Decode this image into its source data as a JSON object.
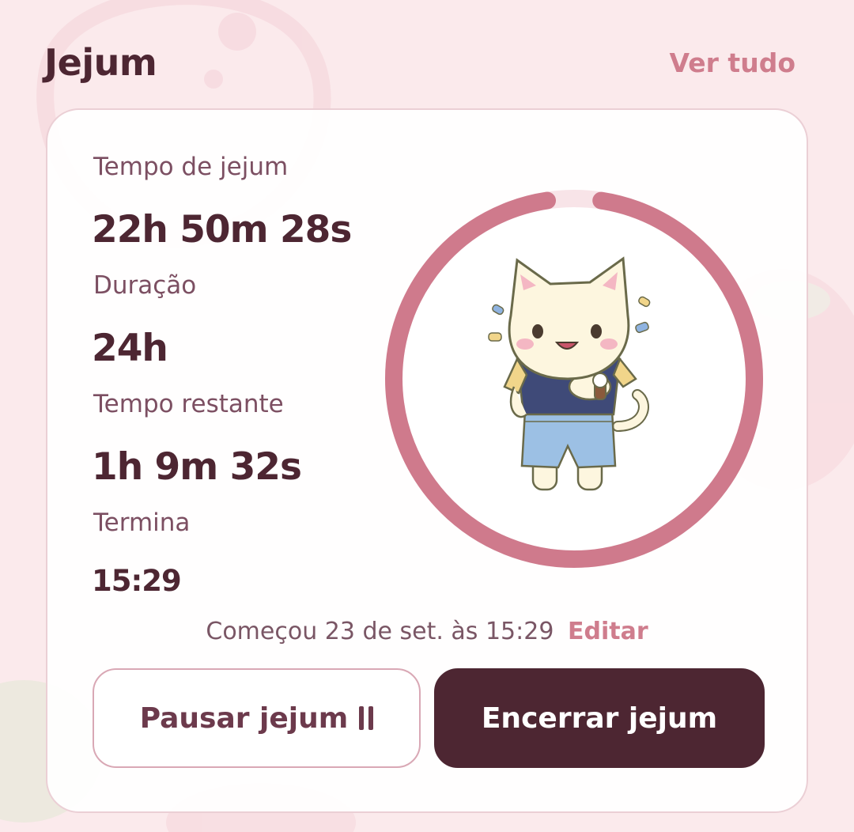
{
  "header": {
    "title": "Jejum",
    "see_all": "Ver tudo"
  },
  "stats": {
    "elapsed_label": "Tempo de jejum",
    "elapsed_value": "22h 50m 28s",
    "duration_label": "Duração",
    "duration_value": "24h",
    "remaining_label": "Tempo restante",
    "remaining_value": "1h 9m 32s",
    "ends_label": "Termina",
    "ends_value": "15:29"
  },
  "progress": {
    "fraction": 0.952,
    "color": "#cf7a8c",
    "track_color": "#f8e4e8"
  },
  "mascot": {
    "icon": "cat-mascot-checking-watch-icon"
  },
  "started": {
    "text": "Começou 23 de set. às 15:29",
    "edit_label": "Editar"
  },
  "actions": {
    "pause_label": "Pausar jejum",
    "end_label": "Encerrar jejum"
  },
  "colors": {
    "background": "#fbeaec",
    "accent": "#cf7d8d",
    "dark": "#4d2632"
  }
}
